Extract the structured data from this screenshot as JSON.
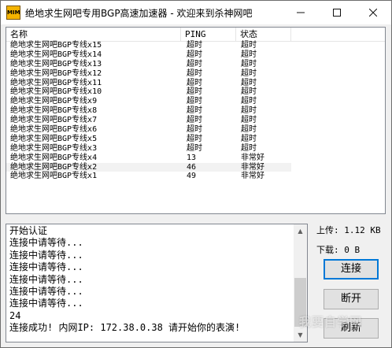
{
  "window": {
    "title": "绝地求生网吧专用BGP高速加速器 - 欢迎来到杀神网吧",
    "icon_text": "MIM",
    "controls": {
      "minimize": "—",
      "maximize": "☐",
      "close": "✕"
    }
  },
  "server_list": {
    "columns": {
      "name": "名称",
      "ping": "PING",
      "state": "状态"
    },
    "rows": [
      {
        "name": "绝地求生网吧BGP专线x15",
        "ping": "超时",
        "state": "超时"
      },
      {
        "name": "绝地求生网吧BGP专线x14",
        "ping": "超时",
        "state": "超时"
      },
      {
        "name": "绝地求生网吧BGP专线x13",
        "ping": "超时",
        "state": "超时"
      },
      {
        "name": "绝地求生网吧BGP专线x12",
        "ping": "超时",
        "state": "超时"
      },
      {
        "name": "绝地求生网吧BGP专线x11",
        "ping": "超时",
        "state": "超时"
      },
      {
        "name": "绝地求生网吧BGP专线x10",
        "ping": "超时",
        "state": "超时"
      },
      {
        "name": "绝地求生网吧BGP专线x9",
        "ping": "超时",
        "state": "超时"
      },
      {
        "name": "绝地求生网吧BGP专线x8",
        "ping": "超时",
        "state": "超时"
      },
      {
        "name": "绝地求生网吧BGP专线x7",
        "ping": "超时",
        "state": "超时"
      },
      {
        "name": "绝地求生网吧BGP专线x6",
        "ping": "超时",
        "state": "超时"
      },
      {
        "name": "绝地求生网吧BGP专线x5",
        "ping": "超时",
        "state": "超时"
      },
      {
        "name": "绝地求生网吧BGP专线x3",
        "ping": "超时",
        "state": "超时"
      },
      {
        "name": "绝地求生网吧BGP专线x4",
        "ping": "13",
        "state": "非常好"
      },
      {
        "name": "绝地求生网吧BGP专线x2",
        "ping": "46",
        "state": "非常好",
        "selected": true
      },
      {
        "name": "绝地求生网吧BGP专线x1",
        "ping": "49",
        "state": "非常好"
      }
    ]
  },
  "log": {
    "lines": [
      "开始认证",
      "连接中请等待...",
      "连接中请等待...",
      "连接中请等待...",
      "连接中请等待...",
      "连接中请等待...",
      "连接中请等待...",
      "24",
      "连接成功! 内网IP: 172.38.0.38 请开始你的表演!"
    ]
  },
  "stats": {
    "upload": "上传: 1.12 KB",
    "download": "下载: 0 B"
  },
  "buttons": {
    "connect": "连接",
    "disconnect": "断开",
    "refresh": "刷新"
  },
  "watermark": "我要自学网",
  "colors": {
    "accent": "#0078d7",
    "selected_row": "#f2f2f2"
  }
}
